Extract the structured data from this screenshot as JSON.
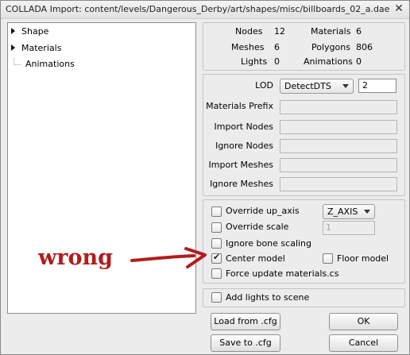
{
  "window": {
    "title": "COLLADA Import: content/levels/Dangerous_Derby/art/shapes/misc/billboards_02_a.dae",
    "close_glyph": "✕"
  },
  "tree": {
    "items": [
      {
        "label": "Shape",
        "expandable": true
      },
      {
        "label": "Materials",
        "expandable": true
      },
      {
        "label": "Animations",
        "expandable": false
      }
    ]
  },
  "stats": {
    "nodes_label": "Nodes",
    "nodes_value": "12",
    "materials_label": "Materials",
    "materials_value": "6",
    "meshes_label": "Meshes",
    "meshes_value": "6",
    "polygons_label": "Polygons",
    "polygons_value": "806",
    "lights_label": "Lights",
    "lights_value": "0",
    "animations_label": "Animations",
    "animations_value": "0"
  },
  "fields": {
    "lod_label": "LOD",
    "lod_selected": "DetectDTS",
    "lod_value": "2",
    "materials_prefix_label": "Materials Prefix",
    "import_nodes_label": "Import Nodes",
    "ignore_nodes_label": "Ignore Nodes",
    "import_meshes_label": "Import Meshes",
    "ignore_meshes_label": "Ignore Meshes"
  },
  "options": {
    "override_up_axis": {
      "label": "Override up_axis",
      "checked": false
    },
    "up_axis_selected": "Z_AXIS",
    "override_scale": {
      "label": "Override scale",
      "checked": false
    },
    "scale_value": "1",
    "ignore_bone_scaling": {
      "label": "Ignore bone scaling",
      "checked": false
    },
    "center_model": {
      "label": "Center model",
      "checked": true,
      "check_glyph": "✔"
    },
    "floor_model": {
      "label": "Floor model",
      "checked": false
    },
    "force_update_materials": {
      "label": "Force update materials.cs",
      "checked": false
    }
  },
  "lights_option": {
    "label": "Add lights to scene",
    "checked": false
  },
  "buttons": {
    "load": "Load from .cfg",
    "save": "Save to .cfg",
    "ok": "OK",
    "cancel": "Cancel"
  },
  "annotation": {
    "text": "wrong",
    "color": "#b21c1c"
  }
}
